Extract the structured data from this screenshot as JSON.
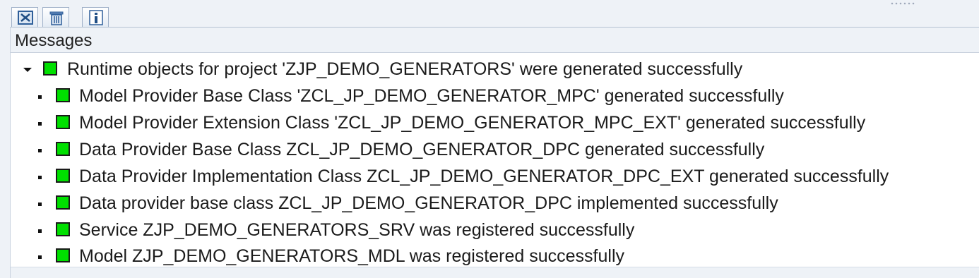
{
  "toolbar": {
    "buttons": [
      {
        "icon": "close-document-icon"
      },
      {
        "icon": "trash-icon"
      },
      {
        "icon": "info-icon"
      }
    ]
  },
  "messages": {
    "header": "Messages",
    "root": {
      "text": "Runtime objects for project 'ZJP_DEMO_GENERATORS' were generated successfully",
      "status": "success",
      "expanded": true
    },
    "children": [
      {
        "text": "Model Provider Base Class 'ZCL_JP_DEMO_GENERATOR_MPC' generated successfully",
        "status": "success"
      },
      {
        "text": "Model Provider Extension Class 'ZCL_JP_DEMO_GENERATOR_MPC_EXT' generated successfully",
        "status": "success"
      },
      {
        "text": "Data Provider Base Class ZCL_JP_DEMO_GENERATOR_DPC generated successfully",
        "status": "success"
      },
      {
        "text": "Data Provider Implementation Class ZCL_JP_DEMO_GENERATOR_DPC_EXT generated successfully",
        "status": "success"
      },
      {
        "text": "Data provider base class ZCL_JP_DEMO_GENERATOR_DPC implemented successfully",
        "status": "success"
      },
      {
        "text": "Service ZJP_DEMO_GENERATORS_SRV was registered successfully",
        "status": "success"
      },
      {
        "text": "Model ZJP_DEMO_GENERATORS_MDL was registered successfully",
        "status": "success"
      }
    ]
  },
  "colors": {
    "success": "#00e000",
    "background": "#eef2f7"
  }
}
